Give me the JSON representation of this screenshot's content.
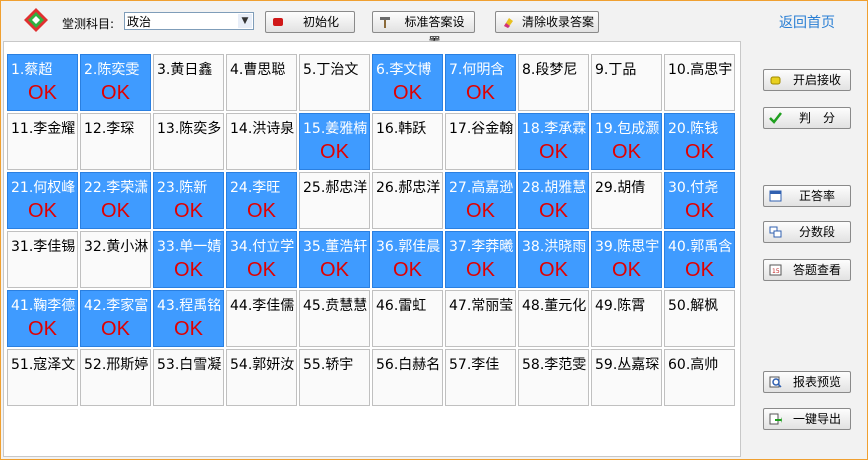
{
  "toolbar": {
    "subject_label": "堂测科目:",
    "subject_value": "政治",
    "init_label": "初始化",
    "standard_answer_label": "标准答案设置",
    "clear_label": "清除收录答案",
    "home_label": "返回首页"
  },
  "side_buttons": {
    "start_receive": "开启接收",
    "grade": "判　分",
    "correct_rate": "正答率",
    "score_segment": "分数段",
    "answer_view": "答题查看",
    "report_preview": "报表预览",
    "export": "一键导出"
  },
  "colors": {
    "ok_bg": "#3f9bff",
    "ok_text": "#e00000",
    "accent": "#2a7fd4"
  },
  "students": [
    {
      "label": "1.蔡超",
      "status": "OK"
    },
    {
      "label": "2.陈奕雯",
      "status": "OK"
    },
    {
      "label": "3.黄日鑫",
      "status": ""
    },
    {
      "label": "4.曹思聪",
      "status": ""
    },
    {
      "label": "5.丁治文",
      "status": ""
    },
    {
      "label": "6.李文博",
      "status": "OK"
    },
    {
      "label": "7.何明含",
      "status": "OK"
    },
    {
      "label": "8.段梦尼",
      "status": ""
    },
    {
      "label": "9.丁品",
      "status": ""
    },
    {
      "label": "10.高思宇",
      "status": ""
    },
    {
      "label": "11.李金耀",
      "status": ""
    },
    {
      "label": "12.李琛",
      "status": ""
    },
    {
      "label": "13.陈奕多",
      "status": ""
    },
    {
      "label": "14.洪诗泉",
      "status": ""
    },
    {
      "label": "15.姜雅楠",
      "status": "OK"
    },
    {
      "label": "16.韩跃",
      "status": ""
    },
    {
      "label": "17.谷金翰",
      "status": ""
    },
    {
      "label": "18.李承霖",
      "status": "OK"
    },
    {
      "label": "19.包成灏",
      "status": "OK"
    },
    {
      "label": "20.陈钱",
      "status": "OK"
    },
    {
      "label": "21.何权峰",
      "status": "OK"
    },
    {
      "label": "22.李荣潇",
      "status": "OK"
    },
    {
      "label": "23.陈新",
      "status": "OK"
    },
    {
      "label": "24.李旺",
      "status": "OK"
    },
    {
      "label": "25.郝忠洋",
      "status": ""
    },
    {
      "label": "26.郝忠洋",
      "status": ""
    },
    {
      "label": "27.高嘉逊",
      "status": "OK"
    },
    {
      "label": "28.胡雅慧",
      "status": "OK"
    },
    {
      "label": "29.胡倩",
      "status": ""
    },
    {
      "label": "30.付尧",
      "status": "OK"
    },
    {
      "label": "31.李佳锡",
      "status": ""
    },
    {
      "label": "32.黄小淋",
      "status": ""
    },
    {
      "label": "33.单一婧",
      "status": "OK"
    },
    {
      "label": "34.付立学",
      "status": "OK"
    },
    {
      "label": "35.董浩轩",
      "status": "OK"
    },
    {
      "label": "36.郭佳晨",
      "status": "OK"
    },
    {
      "label": "37.李莽曦",
      "status": "OK"
    },
    {
      "label": "38.洪晓雨",
      "status": "OK"
    },
    {
      "label": "39.陈思宇",
      "status": "OK"
    },
    {
      "label": "40.郭禹含",
      "status": "OK"
    },
    {
      "label": "41.鞠李德",
      "status": "OK"
    },
    {
      "label": "42.李家富",
      "status": "OK"
    },
    {
      "label": "43.程禹铭",
      "status": "OK"
    },
    {
      "label": "44.李佳儒",
      "status": ""
    },
    {
      "label": "45.贲慧慧",
      "status": ""
    },
    {
      "label": "46.雷虹",
      "status": ""
    },
    {
      "label": "47.常丽莹",
      "status": ""
    },
    {
      "label": "48.董元化",
      "status": ""
    },
    {
      "label": "49.陈霄",
      "status": ""
    },
    {
      "label": "50.解枫",
      "status": ""
    },
    {
      "label": "51.寇泽文",
      "status": ""
    },
    {
      "label": "52.邢斯婷",
      "status": ""
    },
    {
      "label": "53.白雪凝",
      "status": ""
    },
    {
      "label": "54.郭妍汝",
      "status": ""
    },
    {
      "label": "55.轿宇",
      "status": ""
    },
    {
      "label": "56.白赫名",
      "status": ""
    },
    {
      "label": "57.李佳",
      "status": ""
    },
    {
      "label": "58.李范雯",
      "status": ""
    },
    {
      "label": "59.丛嘉琛",
      "status": ""
    },
    {
      "label": "60.高帅",
      "status": ""
    }
  ]
}
